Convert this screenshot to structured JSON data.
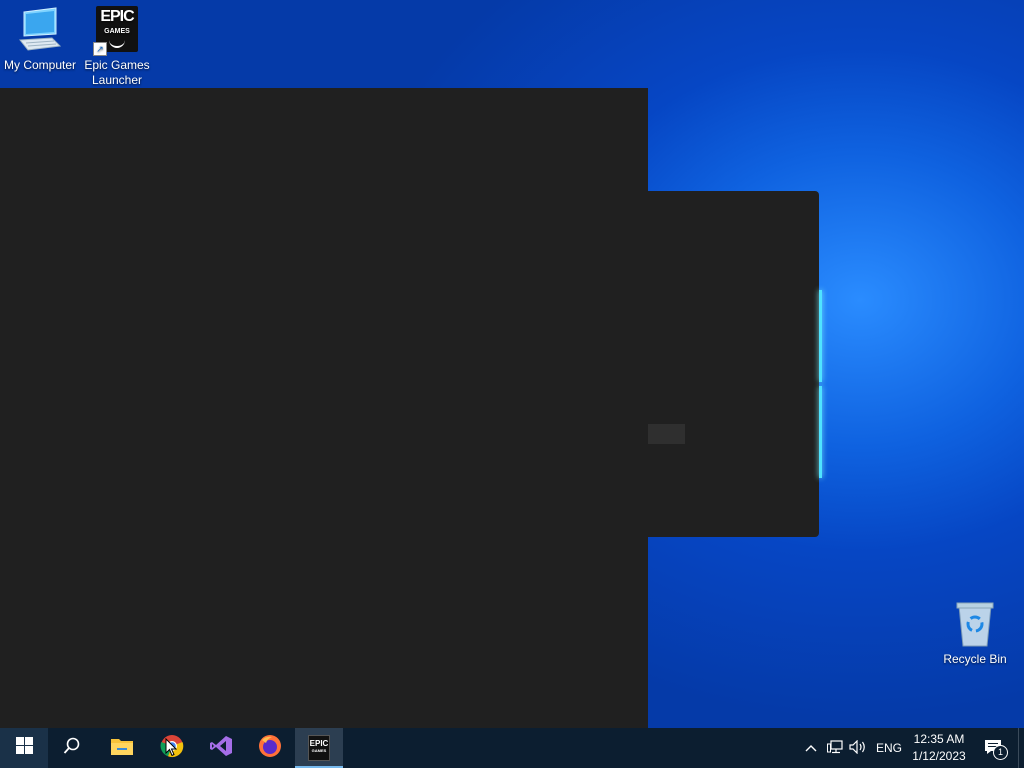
{
  "desktop": {
    "icons": [
      {
        "label": "My Computer",
        "icon": "computer-icon"
      },
      {
        "label": "Epic Games Launcher",
        "icon": "epic-games-icon",
        "logo_text_top": "EPIC",
        "logo_text_bottom": "GAMES"
      },
      {
        "label": "Recycle Bin",
        "icon": "recycle-bin-icon"
      }
    ]
  },
  "taskbar": {
    "apps": [
      {
        "name": "start",
        "icon": "windows-icon"
      },
      {
        "name": "search",
        "icon": "search-icon"
      },
      {
        "name": "file-explorer",
        "icon": "folder-icon"
      },
      {
        "name": "chrome",
        "icon": "chrome-icon"
      },
      {
        "name": "visual-studio",
        "icon": "visual-studio-icon"
      },
      {
        "name": "firefox",
        "icon": "firefox-icon"
      },
      {
        "name": "epic-games",
        "icon": "epic-games-icon",
        "active": true,
        "logo_text_top": "EPIC",
        "logo_text_bottom": "GAMES"
      }
    ],
    "tray": {
      "language": "ENG",
      "time": "12:35 AM",
      "date": "1/12/2023",
      "notification_count": "1"
    }
  },
  "colors": {
    "window_bg": "#202020",
    "taskbar_bg": "#0c1e30",
    "accent_glow": "#4fe3ff"
  }
}
